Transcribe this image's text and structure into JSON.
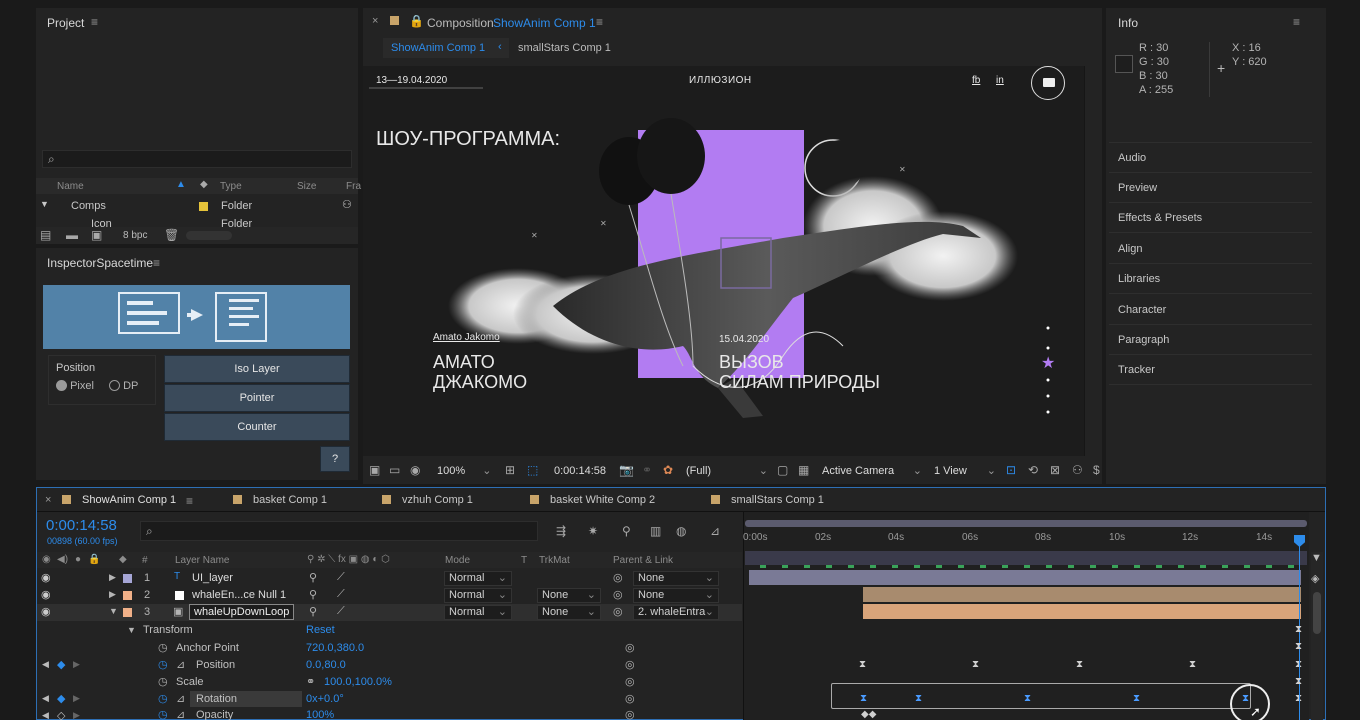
{
  "project": {
    "title": "Project",
    "search_placeholder": "",
    "columns": [
      "Name",
      "Type",
      "Size",
      "Fra"
    ],
    "rows": [
      {
        "name": "Comps",
        "type": "Folder"
      },
      {
        "name": "Icon",
        "type": "Folder"
      }
    ],
    "bpc": "8 bpc"
  },
  "inspector": {
    "title": "InspectorSpacetime",
    "position_label": "Position",
    "radio_pixel": "Pixel",
    "radio_dp": "DP",
    "buttons": [
      "Iso Layer",
      "Pointer",
      "Counter"
    ],
    "help": "?"
  },
  "composition": {
    "tab_prefix": "Composition",
    "tab_name": "ShowAnim Comp 1",
    "breadcrumb_active": "ShowAnim Comp 1",
    "breadcrumb_other": "smallStars Comp 1",
    "footer": {
      "zoom": "100%",
      "timecode": "0:00:14:58",
      "resolution": "(Full)",
      "camera": "Active Camera",
      "views": "1 View"
    }
  },
  "artwork": {
    "date_range": "13—19.04.2020",
    "brand": "ИЛЛЮЗИОН",
    "link_fb": "fb",
    "link_in": "in",
    "headline": "ШОУ-ПРОГРАММА:",
    "left_small": "Amato Jakomo",
    "left_big_1": "АМАТО",
    "left_big_2": "ДЖАКОМО",
    "right_small": "15.04.2020",
    "right_big_1": "ВЫЗОВ",
    "right_big_2": "СИЛАМ ПРИРОДЫ",
    "accent_color": "#b27cf2"
  },
  "info": {
    "title": "Info",
    "r": "R : 30",
    "g": "G : 30",
    "b": "B : 30",
    "a": "A : 255",
    "x": "X : 16",
    "y": "Y : 620"
  },
  "right_panels": [
    "Audio",
    "Preview",
    "Effects & Presets",
    "Align",
    "Libraries",
    "Character",
    "Paragraph",
    "Tracker"
  ],
  "timeline": {
    "tabs": [
      {
        "label": "ShowAnim Comp 1",
        "color": "#c8a46a"
      },
      {
        "label": "basket Comp 1",
        "color": "#c8a46a"
      },
      {
        "label": "vzhuh Comp 1",
        "color": "#c8a46a"
      },
      {
        "label": "basket White Comp 2",
        "color": "#c8a46a"
      },
      {
        "label": "smallStars Comp 1",
        "color": "#c8a46a"
      }
    ],
    "timecode": "0:00:14:58",
    "frames": "00898 (60.00 fps)",
    "headers": {
      "num": "#",
      "layer_name": "Layer Name",
      "mode": "Mode",
      "t": "T",
      "trkmat": "TrkMat",
      "parent": "Parent & Link"
    },
    "layers": [
      {
        "num": "1",
        "name": "UI_layer",
        "mode": "Normal",
        "trkmat": "",
        "parent": "None",
        "color": "#a6a6d6"
      },
      {
        "num": "2",
        "name": "whaleEn...ce Null 1",
        "mode": "Normal",
        "trkmat": "None",
        "parent": "None",
        "color": "#ffffff"
      },
      {
        "num": "3",
        "name": "whaleUpDownLoop",
        "mode": "Normal",
        "trkmat": "None",
        "parent": "2. whaleEntra",
        "color": "#f0b088"
      }
    ],
    "transform": "Transform",
    "reset": "Reset",
    "props": [
      {
        "name": "Anchor Point",
        "value": "720.0,380.0"
      },
      {
        "name": "Position",
        "value": "0.0,80.0"
      },
      {
        "name": "Scale",
        "value": "100.0,100.0%"
      },
      {
        "name": "Rotation",
        "value": "0x+0.0°"
      },
      {
        "name": "Opacity",
        "value": "100%"
      }
    ],
    "ruler": [
      "0:00s",
      "02s",
      "04s",
      "06s",
      "08s",
      "10s",
      "12s",
      "14s"
    ]
  }
}
